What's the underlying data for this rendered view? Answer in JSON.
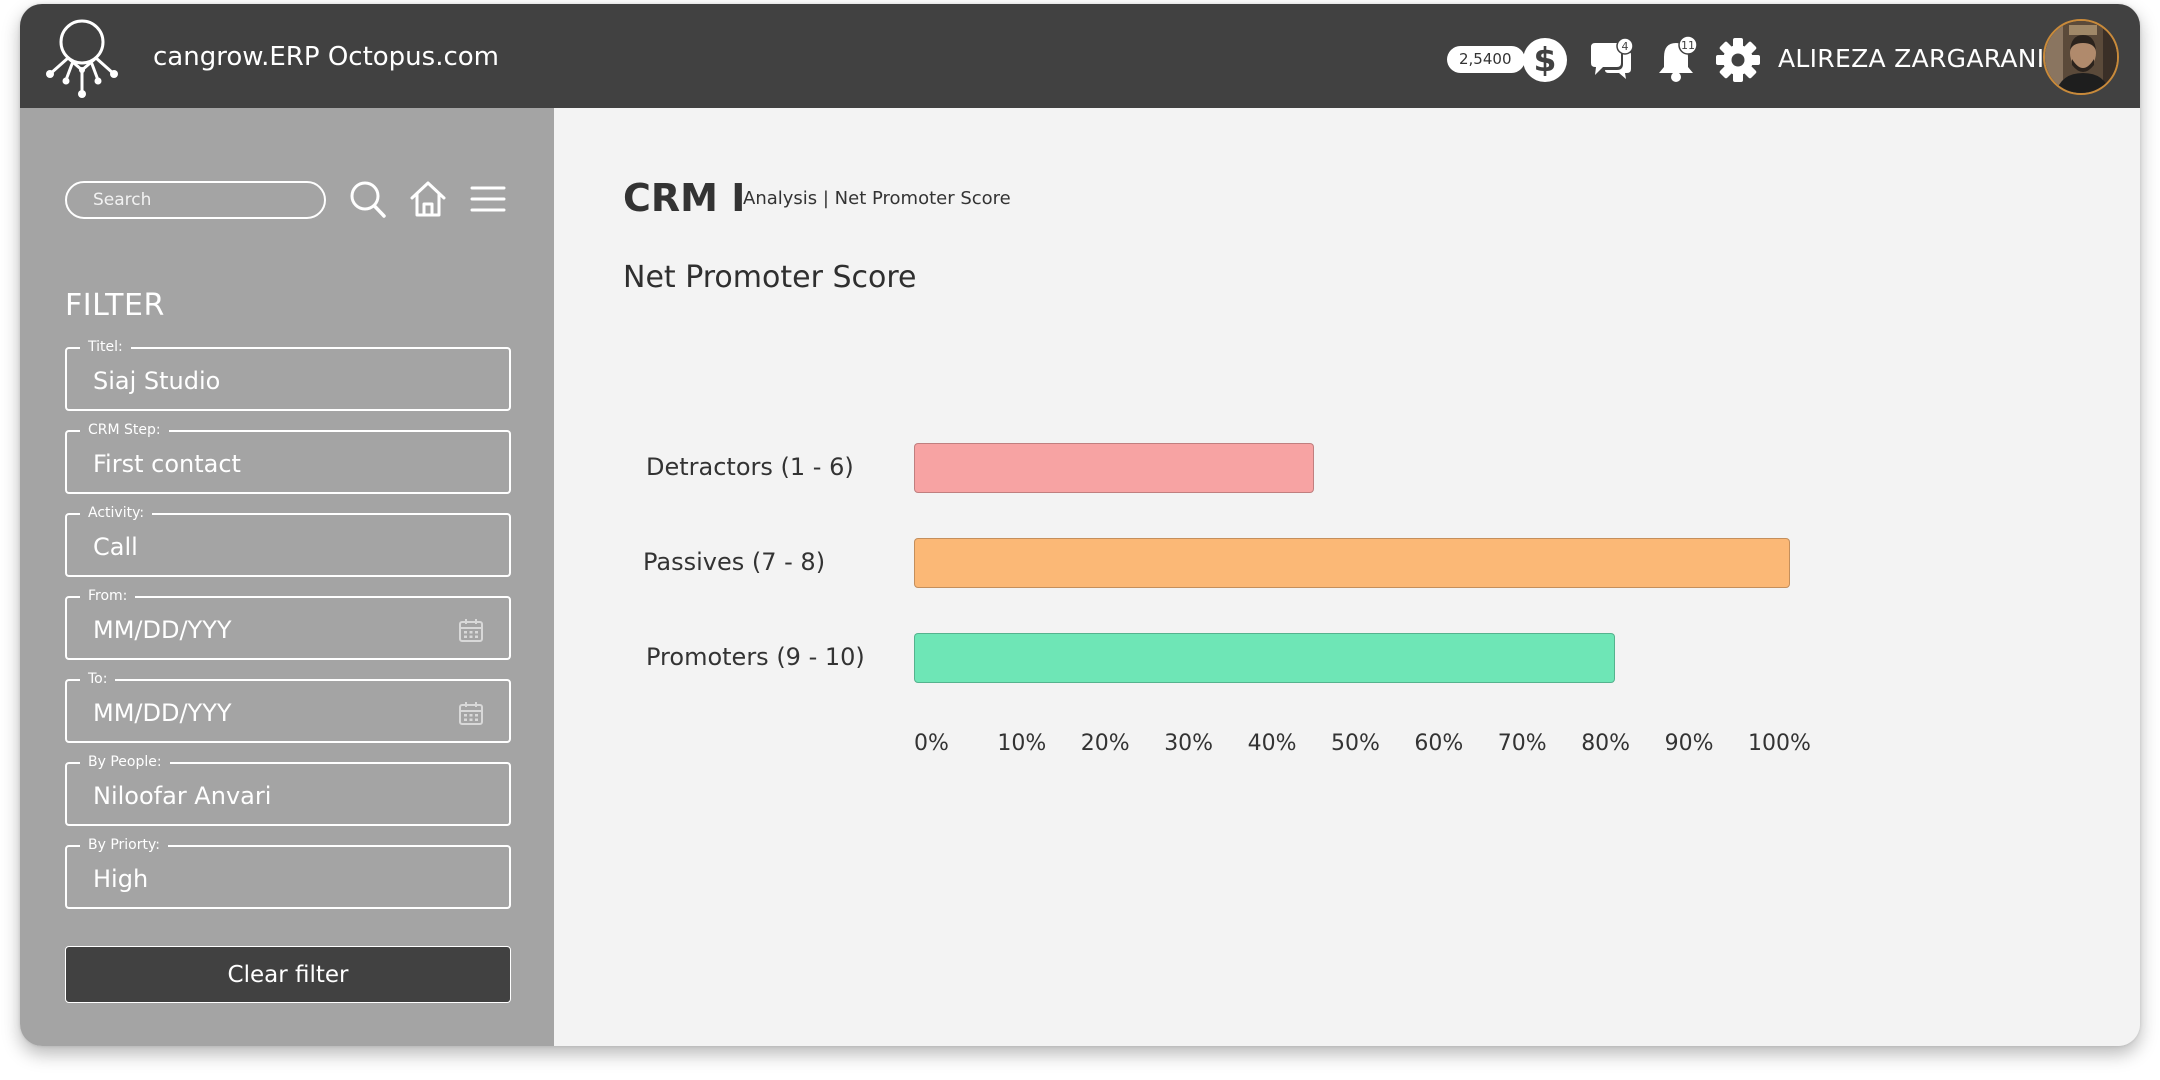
{
  "header": {
    "app_title": "cangrow.ERP Octopus.com",
    "balance": "2,5400",
    "currency_icon": "dollar-icon",
    "messages_count": "4",
    "notifications_count": "11",
    "user_name": "ALIREZA ZARGARANI"
  },
  "sidebar": {
    "search_placeholder": "Search",
    "filter_heading": "FILTER",
    "fields": [
      {
        "label": "Titel:",
        "value": "Siaj Studio",
        "calendar": false
      },
      {
        "label": "CRM Step:",
        "value": "First contact",
        "calendar": false
      },
      {
        "label": "Activity:",
        "value": "Call",
        "calendar": false
      },
      {
        "label": "From:",
        "value": "MM/DD/YYY",
        "calendar": true
      },
      {
        "label": "To:",
        "value": "MM/DD/YYY",
        "calendar": true
      },
      {
        "label": "By People:",
        "value": "Niloofar Anvari",
        "calendar": false
      },
      {
        "label": "By Priorty:",
        "value": "High",
        "calendar": false
      }
    ],
    "clear_label": "Clear filter"
  },
  "main": {
    "crm_title": "CRM I",
    "breadcrumb": "Analysis | Net Promoter Score",
    "chart_title": "Net Promoter Score"
  },
  "chart_data": {
    "type": "bar",
    "orientation": "horizontal",
    "title": "Net Promoter Score",
    "categories": [
      "Detractors (1 - 6)",
      "Passives (7 - 8)",
      "Promoters (9 - 10)"
    ],
    "values": [
      48,
      105,
      84
    ],
    "colors": [
      "#f7a3a3",
      "#fbb876",
      "#6ee6b6"
    ],
    "x_ticks": [
      "0%",
      "10%",
      "20%",
      "30%",
      "40%",
      "50%",
      "60%",
      "70%",
      "80%",
      "90%",
      "100%"
    ],
    "xlim": [
      0,
      100
    ],
    "grid": false,
    "legend": "none"
  }
}
